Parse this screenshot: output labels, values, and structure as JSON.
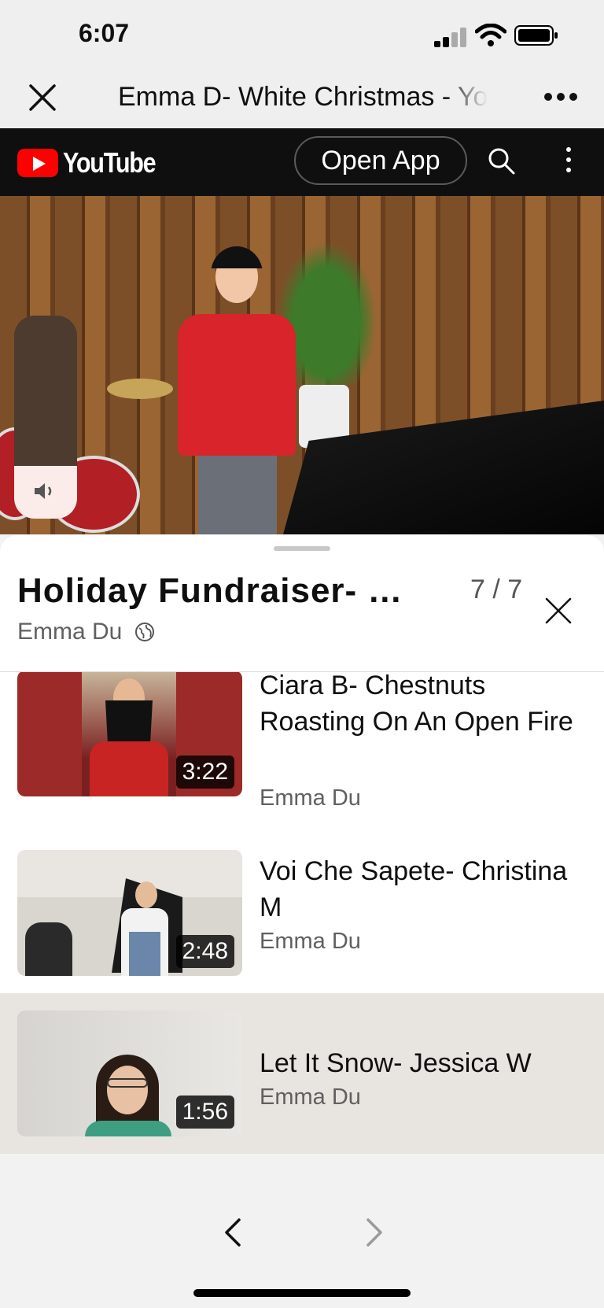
{
  "status_bar": {
    "time": "6:07"
  },
  "browser": {
    "title": "Emma D- White Christmas - YouTube"
  },
  "youtube_bar": {
    "logo_text": "YouTube",
    "open_app_label": "Open App"
  },
  "player": {
    "volume_level": 0.26
  },
  "playlist": {
    "title": "Holiday Fundraiser- …",
    "position": "7 / 7",
    "owner": "Emma Du",
    "items": [
      {
        "title": "Ciara B- Chestnuts Roasting On An Open Fire",
        "channel": "Emma Du",
        "duration": "3:22",
        "active": false
      },
      {
        "title": "Voi Che Sapete- Christina M",
        "channel": "Emma Du",
        "duration": "2:48",
        "active": false
      },
      {
        "title": "Let It Snow- Jessica W",
        "channel": "Emma Du",
        "duration": "1:56",
        "active": true
      }
    ]
  },
  "colors": {
    "youtube_red": "#ff0000",
    "active_row": "#e8e4e0",
    "secondary_text": "#606060"
  }
}
